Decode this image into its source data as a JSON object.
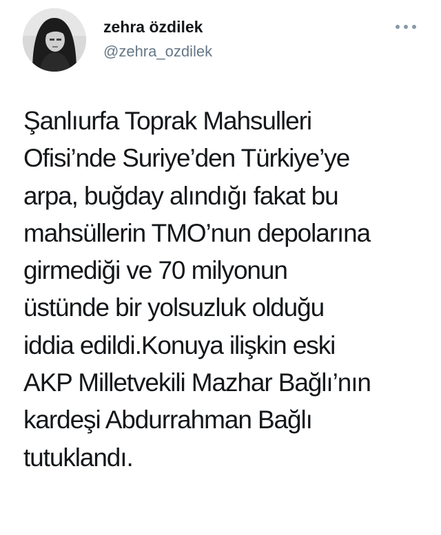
{
  "author": {
    "display_name": "zehra özdilek",
    "handle": "@zehra_ozdilek"
  },
  "menu": {
    "icon": "more-horizontal-icon"
  },
  "tweet": {
    "lines": [
      "Şanlıurfa Toprak Mahsulleri",
      "Ofisi’nde Suriye’den Türkiye’ye",
      "arpa, buğday alındığı fakat bu",
      "mahsüllerin TMO’nun depolarına",
      "girmediği ve 70 milyonun",
      "üstünde bir yolsuzluk olduğu",
      "iddia edildi.Konuya ilişkin eski",
      "AKP Milletvekili Mazhar Bağlı’nın",
      "kardeşi Abdurrahman Bağlı",
      "tutuklandı."
    ]
  },
  "colors": {
    "text": "#14171a",
    "secondary": "#657786",
    "icon": "#8899a6"
  }
}
